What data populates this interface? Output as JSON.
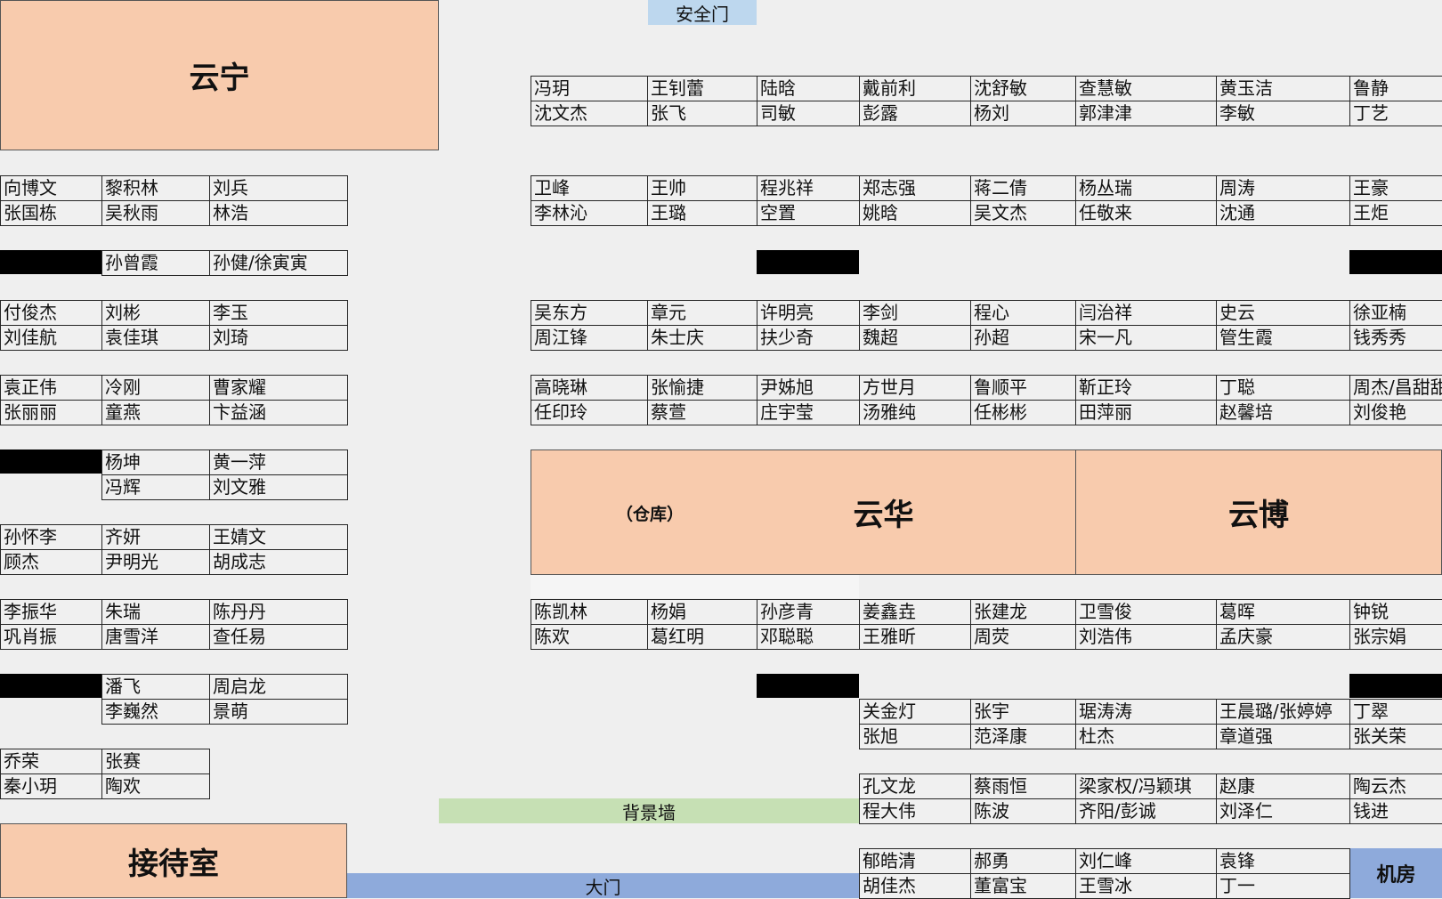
{
  "rooms": {
    "yunning": "云宁",
    "yunhua": "云华",
    "yunbo": "云博",
    "reception": "接待室",
    "server_room": "机房",
    "warehouse_note": "（仓库）"
  },
  "bands": {
    "safety_door": "安全门",
    "background_wall": "背景墙",
    "main_gate": "大门"
  },
  "left": {
    "g1": {
      "r1": [
        "向博文",
        "黎积林",
        "刘兵"
      ],
      "r2": [
        "张国栋",
        "吴秋雨",
        "林浩"
      ]
    },
    "g2": {
      "r1": [
        "孙曾霞",
        "孙健/徐寅寅"
      ]
    },
    "g3": {
      "r1": [
        "付俊杰",
        "刘彬",
        "李玉"
      ],
      "r2": [
        "刘佳航",
        "袁佳琪",
        "刘琦"
      ]
    },
    "g4": {
      "r1": [
        "袁正伟",
        "冷刚",
        "曹家耀"
      ],
      "r2": [
        "张丽丽",
        "童燕",
        "卞益涵"
      ]
    },
    "g5": {
      "r1": [
        "杨坤",
        "黄一萍"
      ],
      "r2": [
        "冯辉",
        "刘文雅"
      ]
    },
    "g6": {
      "r1": [
        "孙怀李",
        "齐妍",
        "王婧文"
      ],
      "r2": [
        "顾杰",
        "尹明光",
        "胡成志"
      ]
    },
    "g7": {
      "r1": [
        "李振华",
        "朱瑞",
        "陈丹丹"
      ],
      "r2": [
        "巩肖振",
        "唐雪洋",
        "查任易"
      ]
    },
    "g8": {
      "r1": [
        "潘飞",
        "周启龙"
      ],
      "r2": [
        "李巍然",
        "景萌"
      ]
    },
    "g9": {
      "r1": [
        "乔荣",
        "张赛"
      ],
      "r2": [
        "秦小玥",
        "陶欢"
      ]
    }
  },
  "right": {
    "g1": {
      "r1": [
        "冯玥",
        "王钊蕾",
        "陆晗",
        "戴前利",
        "沈舒敏",
        "查慧敏",
        "黄玉洁",
        "鲁静"
      ],
      "r2": [
        "沈文杰",
        "张飞",
        "司敏",
        "彭露",
        "杨刘",
        "郭津津",
        "李敏",
        "丁艺"
      ]
    },
    "g2": {
      "r1": [
        "卫峰",
        "王帅",
        "程兆祥",
        "郑志强",
        "蒋二倩",
        "杨丛瑞",
        "周涛",
        "王豪"
      ],
      "r2": [
        "李林沁",
        "王璐",
        "空置",
        "姚晗",
        "吴文杰",
        "任敬来",
        "沈通",
        "王炬"
      ]
    },
    "g3": {
      "r1": [
        "吴东方",
        "章元",
        "许明亮",
        "李剑",
        "程心",
        "闫治祥",
        "史云",
        "徐亚楠"
      ],
      "r2": [
        "周江锋",
        "朱士庆",
        "扶少奇",
        "魏超",
        "孙超",
        "宋一凡",
        "管生霞",
        "钱秀秀"
      ]
    },
    "g4": {
      "r1": [
        "高晓琳",
        "张愉捷",
        "尹姊旭",
        "方世月",
        "鲁顺平",
        "靳正玲",
        "丁聪",
        "周杰/昌甜甜"
      ],
      "r2": [
        "任印玲",
        "蔡萱",
        "庄宇莹",
        "汤雅纯",
        "任彬彬",
        "田萍丽",
        "赵馨培",
        "刘俊艳"
      ]
    },
    "g5": {
      "r1": [
        "陈凯林",
        "杨娟",
        "孙彦青",
        "姜鑫垚",
        "张建龙",
        "卫雪俊",
        "葛晖",
        "钟锐"
      ],
      "r2": [
        "陈欢",
        "葛红明",
        "邓聪聪",
        "王雅昕",
        "周荧",
        "刘浩伟",
        "孟庆豪",
        "张宗娟"
      ]
    },
    "g6": {
      "r1": [
        "关金灯",
        "张宇",
        "琚涛涛",
        "王晨璐/张婷婷",
        "丁翠"
      ],
      "r2": [
        "张旭",
        "范泽康",
        "杜杰",
        "章道强",
        "张关荣"
      ]
    },
    "g7": {
      "r1": [
        "孔文龙",
        "蔡雨恒",
        "梁家权/冯颖琪",
        "赵康",
        "陶云杰"
      ],
      "r2": [
        "程大伟",
        "陈波",
        "齐阳/彭诚",
        "刘泽仁",
        "钱进"
      ]
    },
    "g8": {
      "r1": [
        "郁皓清",
        "郝勇",
        "刘仁峰",
        "袁锋"
      ],
      "r2": [
        "胡佳杰",
        "董富宝",
        "王雪冰",
        "丁一"
      ]
    }
  },
  "colors": {
    "room_fill": "#f8cbad",
    "safety_door": "#bdd7ee",
    "background_wall": "#c6e0b4",
    "main_gate": "#8eaadb",
    "grid_background": "#efefef"
  }
}
